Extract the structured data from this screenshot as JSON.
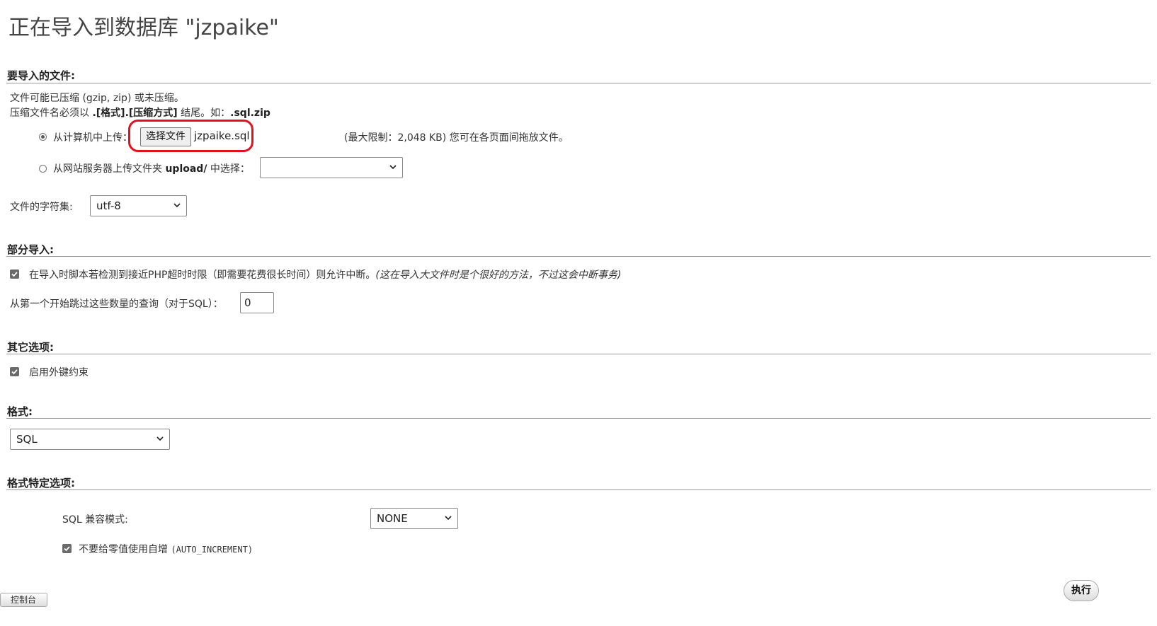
{
  "title": "正在导入到数据库 \"jzpaike\"",
  "file_section": {
    "heading": "要导入的文件:",
    "note_line1": "文件可能已压缩 (gzip, zip) 或未压缩。",
    "note_line2_prefix": "压缩文件名必须以 ",
    "note_line2_bold": ".[格式].[压缩方式]",
    "note_line2_mid": " 结尾。如：",
    "note_line2_example": ".sql.zip",
    "upload_radio_label": "从计算机中上传：",
    "choose_file_button": "选择文件",
    "chosen_file_name": "jzpaike.sql",
    "max_limit_text": "(最大限制：2,048 KB) 您可在各页面间拖放文件。",
    "server_radio_prefix": "从网站服务器上传文件夹 ",
    "server_radio_folder": "upload/",
    "server_radio_suffix": " 中选择：",
    "server_select_value": "",
    "charset_label": "文件的字符集:",
    "charset_value": "utf-8"
  },
  "partial_section": {
    "heading": "部分导入:",
    "allow_interrupt_label": "在导入时脚本若检测到接近PHP超时时限（即需要花费很长时间）则允许中断。",
    "allow_interrupt_hint": "(这在导入大文件时是个很好的方法，不过这会中断事务)",
    "allow_interrupt_checked": true,
    "skip_queries_label": "从第一个开始跳过这些数量的查询（对于SQL）：",
    "skip_queries_value": "0"
  },
  "other_section": {
    "heading": "其它选项:",
    "foreign_keys_label": "启用外键约束",
    "foreign_keys_checked": true
  },
  "format_section": {
    "heading": "格式:",
    "format_value": "SQL"
  },
  "format_options_section": {
    "heading": "格式特定选项:",
    "compat_label": "SQL 兼容模式:",
    "compat_value": "NONE",
    "no_auto_value_label": "不要给零值使用自增",
    "no_auto_value_code": "(AUTO_INCREMENT)",
    "no_auto_value_checked": true
  },
  "actions": {
    "go_button": "执行",
    "bottom_tab_label": "控制台"
  },
  "colors": {
    "highlight": "#e3101f",
    "rule": "#9a9a9a"
  }
}
